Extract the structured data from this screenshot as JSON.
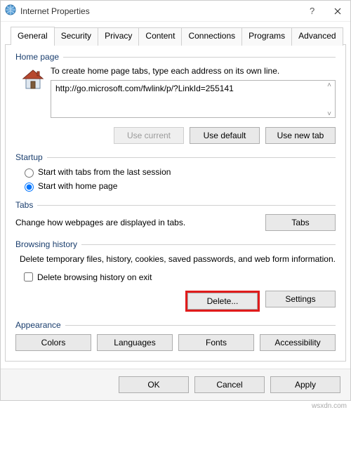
{
  "window": {
    "title": "Internet Properties"
  },
  "tabs": [
    "General",
    "Security",
    "Privacy",
    "Content",
    "Connections",
    "Programs",
    "Advanced"
  ],
  "active_tab": 0,
  "homepage": {
    "label": "Home page",
    "instruction": "To create home page tabs, type each address on its own line.",
    "url": "http://go.microsoft.com/fwlink/p/?LinkId=255141",
    "buttons": {
      "use_current": "Use current",
      "use_default": "Use default",
      "use_new_tab": "Use new tab"
    }
  },
  "startup": {
    "label": "Startup",
    "opt_last": "Start with tabs from the last session",
    "opt_home": "Start with home page",
    "selected": "home"
  },
  "tabs_section": {
    "label": "Tabs",
    "text": "Change how webpages are displayed in tabs.",
    "button": "Tabs"
  },
  "history": {
    "label": "Browsing history",
    "text": "Delete temporary files, history, cookies, saved passwords, and web form information.",
    "checkbox": "Delete browsing history on exit",
    "checked": false,
    "delete": "Delete...",
    "settings": "Settings"
  },
  "appearance": {
    "label": "Appearance",
    "colors": "Colors",
    "languages": "Languages",
    "fonts": "Fonts",
    "accessibility": "Accessibility"
  },
  "dialog": {
    "ok": "OK",
    "cancel": "Cancel",
    "apply": "Apply"
  },
  "watermark": "wsxdn.com"
}
